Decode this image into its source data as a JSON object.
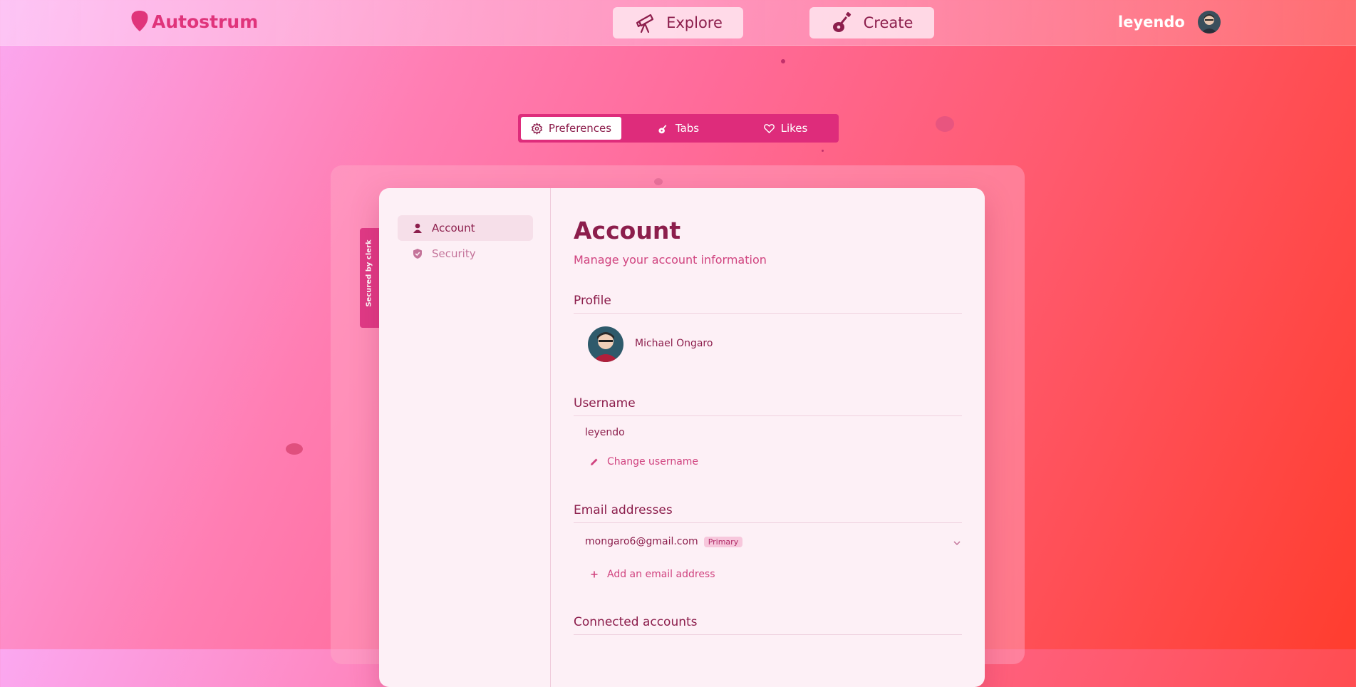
{
  "header": {
    "brand": "Autostrum",
    "explore_label": "Explore",
    "create_label": "Create",
    "username": "leyendo"
  },
  "tabs": [
    {
      "label": "Preferences",
      "icon": "gear-icon",
      "active": true
    },
    {
      "label": "Tabs",
      "icon": "guitar-icon",
      "active": false
    },
    {
      "label": "Likes",
      "icon": "heart-icon",
      "active": false
    }
  ],
  "sidebar": {
    "items": [
      {
        "label": "Account",
        "icon": "user-icon",
        "active": true
      },
      {
        "label": "Security",
        "icon": "shield-icon",
        "active": false
      }
    ],
    "secured_by": "Secured by clerk"
  },
  "account": {
    "title": "Account",
    "subtitle": "Manage your account information",
    "profile_heading": "Profile",
    "profile_name": "Michael Ongaro",
    "username_heading": "Username",
    "username_value": "leyendo",
    "change_username": "Change username",
    "email_heading": "Email addresses",
    "email_value": "mongaro6@gmail.com",
    "email_badge": "Primary",
    "add_email": "Add an email address",
    "connected_heading": "Connected accounts"
  },
  "colors": {
    "accent": "#de2c7b",
    "text": "#8c1e4c",
    "link": "#d0437f"
  }
}
